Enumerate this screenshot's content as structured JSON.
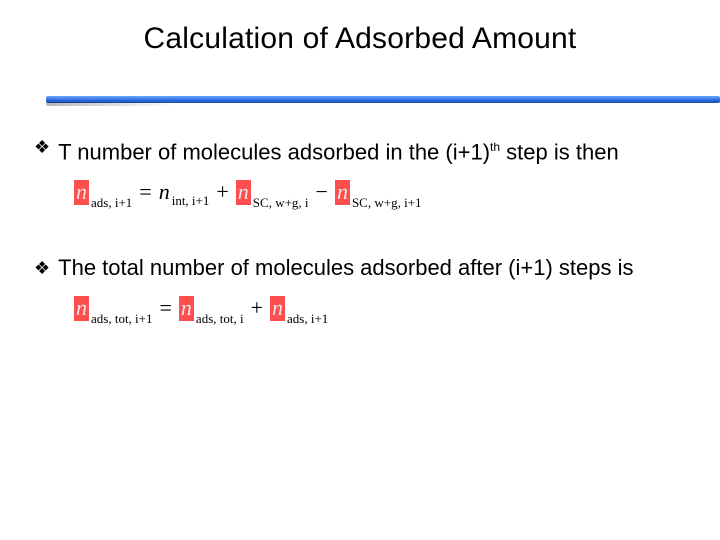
{
  "title": "Calculation of Adsorbed Amount",
  "bullets": {
    "b1_pre": "T number of molecules adsorbed in the (i+1)",
    "b1_sup": "th",
    "b1_post": " step is then",
    "b2": "The total number of molecules adsorbed after (i+1) steps is"
  },
  "eq1": {
    "t1_base": "n",
    "t1_sub": "ads, i+1",
    "op_eq": "=",
    "t2_base": "n",
    "t2_sub": "int, i+1",
    "op_plus": "+",
    "t3_base": "n",
    "t3_sub": "SC, w+g, i",
    "op_minus": "−",
    "t4_base": "n",
    "t4_sub": "SC, w+g, i+1"
  },
  "eq2": {
    "t1_base": "n",
    "t1_sub": "ads, tot, i+1",
    "op_eq": "=",
    "t2_base": "n",
    "t2_sub": "ads, tot, i",
    "op_plus": "+",
    "t3_base": "n",
    "t3_sub": "ads, i+1"
  },
  "glyph": {
    "diamond": "❖"
  }
}
